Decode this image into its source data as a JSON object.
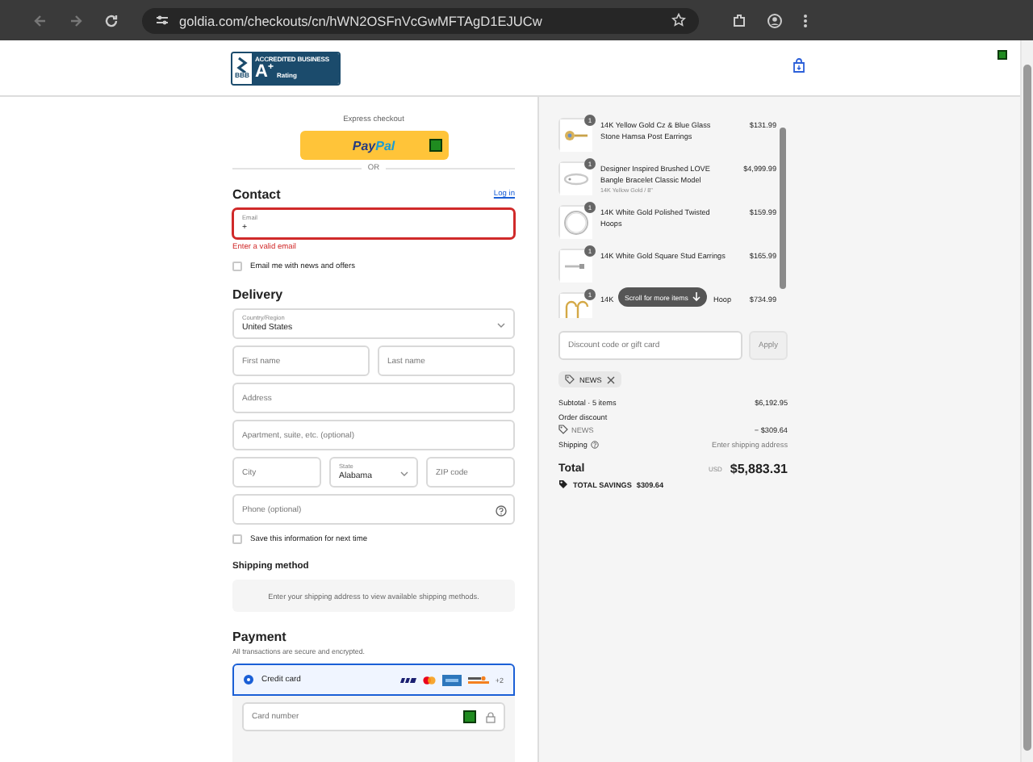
{
  "browser": {
    "url": "goldia.com/checkouts/cn/hWN2OSFnVcGwMFTAgD1EJUCw"
  },
  "logo": {
    "line": "ACCREDITED BUSINESS",
    "grade": "A$^{+}$",
    "rating": "Rating",
    "mark": "BBB"
  },
  "express": {
    "title": "Express checkout",
    "paypal": [
      "Pay",
      "Pal"
    ],
    "divider": "OR"
  },
  "contact": {
    "heading": "Contact",
    "login": "Log in",
    "email": {
      "label": "Email",
      "value": "+",
      "invalid": true
    },
    "error": "Enter a valid email",
    "news": {
      "label": "Email me with news and offers",
      "checked": false
    }
  },
  "delivery": {
    "heading": "Delivery",
    "rows": [
      [
        {
          "kind": "select",
          "label": "Country/Region",
          "value": "United States"
        }
      ],
      [
        {
          "kind": "text",
          "placeholder": "First name"
        },
        {
          "kind": "text",
          "placeholder": "Last name"
        }
      ],
      [
        {
          "kind": "text",
          "placeholder": "Address"
        }
      ],
      [
        {
          "kind": "text",
          "placeholder": "Apartment, suite, etc. (optional)"
        }
      ],
      [
        {
          "kind": "text",
          "placeholder": "City"
        },
        {
          "kind": "select",
          "label": "State",
          "value": "Alabama"
        },
        {
          "kind": "text",
          "placeholder": "ZIP code"
        }
      ],
      [
        {
          "kind": "help",
          "placeholder": "Phone (optional)"
        }
      ]
    ],
    "save": {
      "label": "Save this information for next time",
      "checked": false
    }
  },
  "shipping": {
    "heading": "Shipping method",
    "message": "Enter your shipping address to view available shipping methods."
  },
  "payment": {
    "heading": "Payment",
    "note": "All transactions are secure and encrypted.",
    "methods": [
      {
        "label": "Credit card",
        "selected": true,
        "brands": [
          {
            "kind": "visa"
          },
          {
            "kind": "mastercard"
          },
          {
            "kind": "amex"
          },
          {
            "kind": "discover"
          }
        ],
        "more": "+2"
      }
    ],
    "card": {
      "placeholder": "Card number"
    }
  },
  "summary": {
    "items": [
      {
        "kind": "studs",
        "quantity": "1",
        "name": "14K Yellow Gold Cz & Blue Glass Stone Hamsa Post Earrings",
        "price": "$131.99"
      },
      {
        "kind": "bangle",
        "quantity": "1",
        "name": "Designer Inspired Brushed LOVE Bangle Bracelet Classic Model",
        "variant": "14K Yellow Gold / 8\"",
        "price": "$4,999.99"
      },
      {
        "kind": "hoop",
        "quantity": "1",
        "name": "14K White Gold Polished Twisted Hoops",
        "price": "$159.99"
      },
      {
        "kind": "bar",
        "quantity": "1",
        "name": "14K White Gold Square Stud Earrings",
        "price": "$165.99"
      },
      {
        "kind": "hooks",
        "quantity": "1",
        "name": "14K",
        "name_tail": "Hoop",
        "price": "$734.99"
      }
    ],
    "scroll_hint": "Scroll for more items",
    "discount": {
      "placeholder": "Discount code or gift card",
      "button": "Apply"
    },
    "applied_code": "NEWS",
    "subtotal": {
      "label": "Subtotal · 5 items",
      "value": "$6,192.95"
    },
    "discount_label": "Order discount",
    "discount_line": {
      "label": "NEWS",
      "value": "− $309.64"
    },
    "shipping": {
      "label": "Shipping",
      "value": "Enter shipping address"
    },
    "total": {
      "label": "Total",
      "currency": "USD",
      "value": "$5,883.31"
    },
    "savings": {
      "label": "TOTAL SAVINGS",
      "value": "$309.64"
    }
  }
}
